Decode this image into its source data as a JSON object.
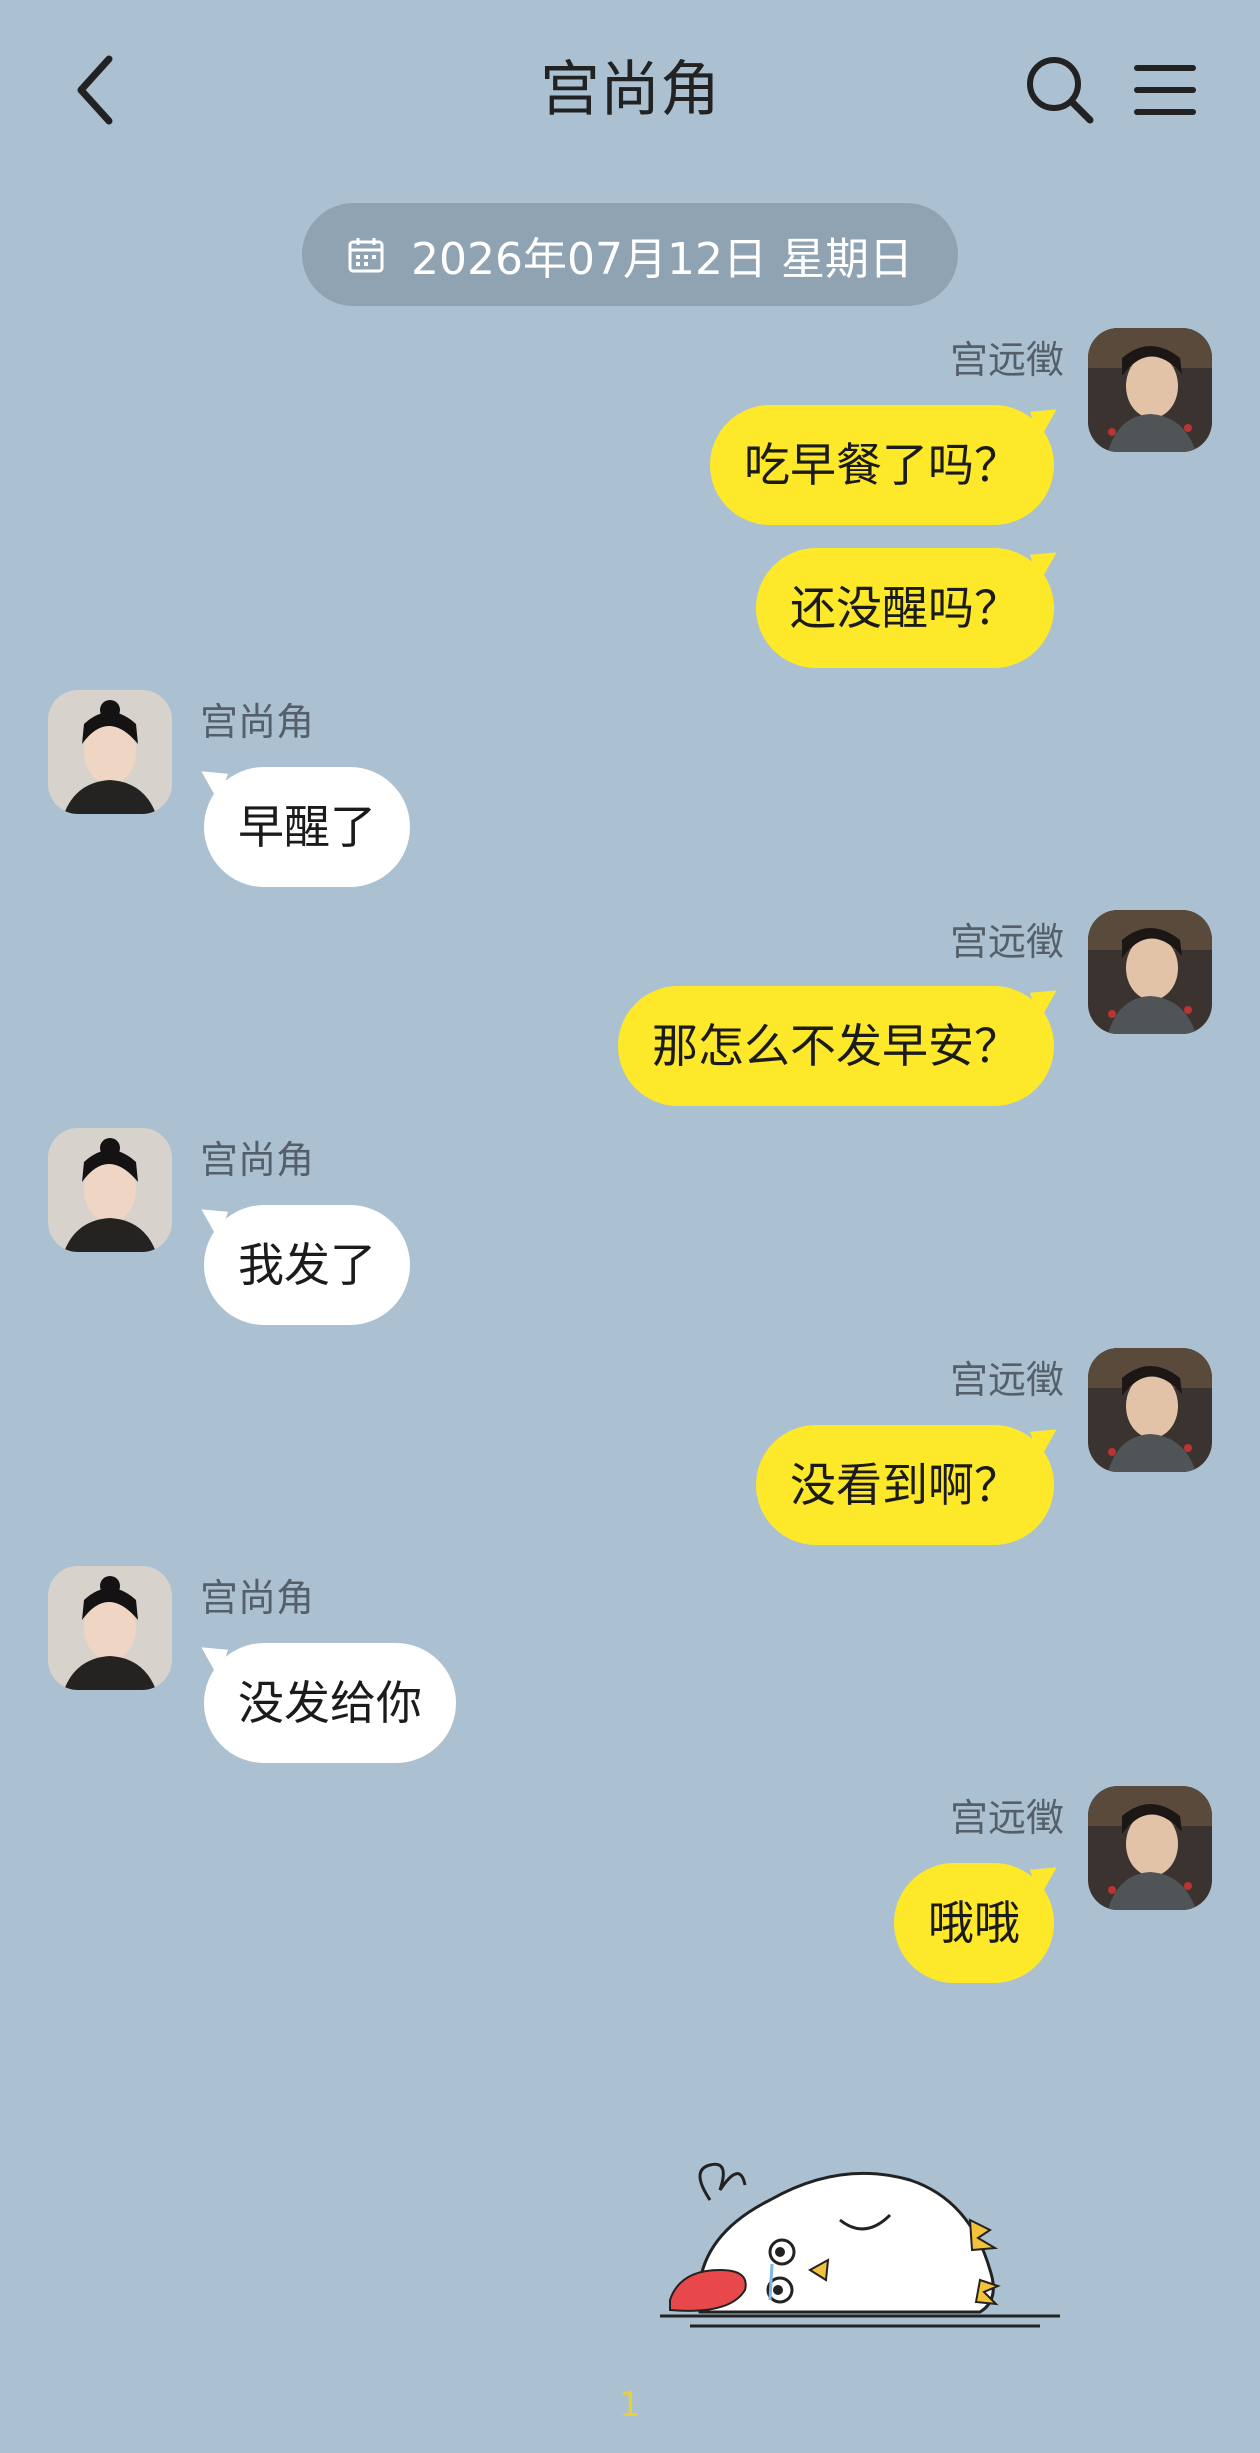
{
  "header": {
    "title": "宫尚角",
    "back_icon": "chevron-left-icon",
    "search_icon": "search-icon",
    "menu_icon": "menu-icon"
  },
  "date_separator": {
    "icon": "calendar-icon",
    "text": "2026年07月12日 星期日"
  },
  "contacts": {
    "me": "宫远徵",
    "other": "宫尚角"
  },
  "messages": [
    {
      "sender": "宫远徵",
      "side": "right",
      "texts": [
        "吃早餐了吗？",
        "还没醒吗？"
      ]
    },
    {
      "sender": "宫尚角",
      "side": "left",
      "texts": [
        "早醒了"
      ]
    },
    {
      "sender": "宫远徵",
      "side": "right",
      "texts": [
        "那怎么不发早安？"
      ]
    },
    {
      "sender": "宫尚角",
      "side": "left",
      "texts": [
        "我发了"
      ]
    },
    {
      "sender": "宫远徵",
      "side": "right",
      "texts": [
        "没看到啊？"
      ]
    },
    {
      "sender": "宫尚角",
      "side": "left",
      "texts": [
        "没发给你"
      ]
    },
    {
      "sender": "宫远徵",
      "side": "right",
      "texts": [
        "哦哦"
      ]
    }
  ],
  "sticker": {
    "description_icon": "crying-chick-sticker"
  },
  "page_number": "1",
  "colors": {
    "background": "#abc1d1",
    "my_bubble": "#fde92a",
    "their_bubble": "#ffffff",
    "date_pill": "#8fa3b3"
  }
}
